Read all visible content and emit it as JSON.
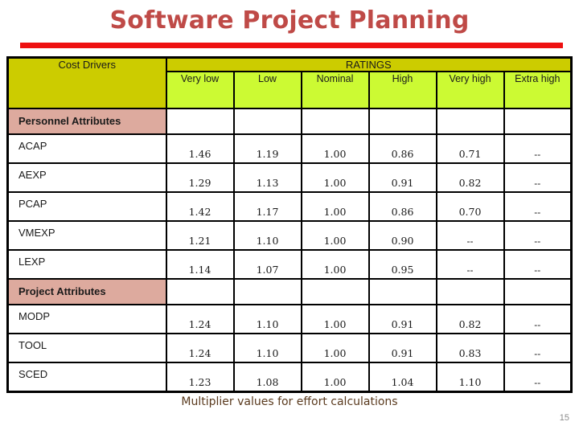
{
  "slide": {
    "title": "Software Project Planning",
    "caption": "Multiplier values for effort calculations",
    "page_number": "15",
    "colors": {
      "title_red": "#bf4a47",
      "rule_red": "#ee1111",
      "header_dark_yellow": "#cccc00",
      "header_green": "#ccfa33",
      "section_salmon": "#ddaa9e",
      "caption_brown": "#5a3a1e",
      "page_number_gray": "#8c8c8c"
    }
  },
  "table": {
    "label_header": "Cost Drivers",
    "group_header": "RATINGS",
    "rating_headers": [
      "Very low",
      "Low",
      "Nominal",
      "High",
      "Very high",
      "Extra high"
    ],
    "sections": [
      {
        "title": "Personnel Attributes",
        "rows": [
          {
            "label": "ACAP",
            "values": [
              "1.46",
              "1.19",
              "1.00",
              "0.86",
              "0.71",
              "--"
            ]
          },
          {
            "label": "AEXP",
            "values": [
              "1.29",
              "1.13",
              "1.00",
              "0.91",
              "0.82",
              "--"
            ]
          },
          {
            "label": "PCAP",
            "values": [
              "1.42",
              "1.17",
              "1.00",
              "0.86",
              "0.70",
              "--"
            ]
          },
          {
            "label": "VMEXP",
            "values": [
              "1.21",
              "1.10",
              "1.00",
              "0.90",
              "--",
              "--"
            ]
          },
          {
            "label": "LEXP",
            "values": [
              "1.14",
              "1.07",
              "1.00",
              "0.95",
              "--",
              "--"
            ]
          }
        ]
      },
      {
        "title": "Project Attributes",
        "rows": [
          {
            "label": "MODP",
            "values": [
              "1.24",
              "1.10",
              "1.00",
              "0.91",
              "0.82",
              "--"
            ]
          },
          {
            "label": "TOOL",
            "values": [
              "1.24",
              "1.10",
              "1.00",
              "0.91",
              "0.83",
              "--"
            ]
          },
          {
            "label": "SCED",
            "values": [
              "1.23",
              "1.08",
              "1.00",
              "1.04",
              "1.10",
              "--"
            ]
          }
        ]
      }
    ]
  }
}
